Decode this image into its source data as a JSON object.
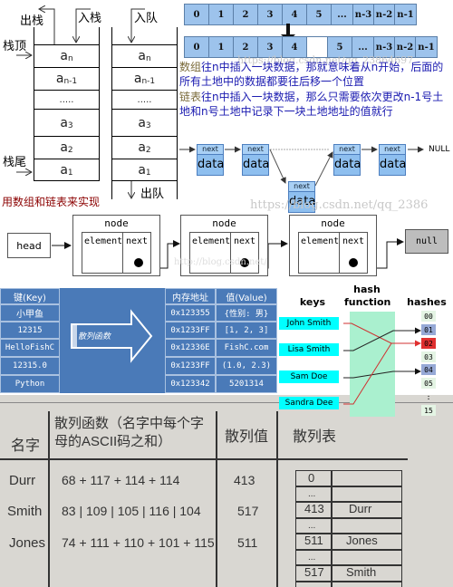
{
  "stack_queue": {
    "stack_pop": "出栈",
    "stack_push": "入栈",
    "queue_enqueue": "入队",
    "queue_dequeue": "出队",
    "stack_top": "栈顶",
    "stack_bottom": "栈尾",
    "cells": [
      {
        "base": "a",
        "sub": "n"
      },
      {
        "base": "a",
        "sub": "n-1"
      },
      {
        "base": ".....",
        "sub": ""
      },
      {
        "base": "a",
        "sub": "3"
      },
      {
        "base": "a",
        "sub": "2"
      },
      {
        "base": "a",
        "sub": "1"
      }
    ],
    "note": "用数组和链表来实现"
  },
  "array": {
    "top_row": [
      "0",
      "1",
      "2",
      "3",
      "4",
      "5",
      "...",
      "n-3",
      "n-2",
      "n-1"
    ],
    "bottom_row_left": [
      "0",
      "1",
      "2",
      "3",
      "4"
    ],
    "bottom_row_right": [
      "5",
      "...",
      "n-3",
      "n-2",
      "n-1"
    ]
  },
  "description": {
    "array_word": "数组",
    "array_text": "往n中插入一块数据，那就意味着从n开始，后面的所有土地中的数据都要往后移一个位置",
    "list_word": "链表",
    "list_text": "往n中插入一块数据，那么只需要依次更改n-1号土地和n号土地中记录下一块土地地址的值就行"
  },
  "linked_list": {
    "next_label": "next",
    "data_label": "data",
    "null_label": "NULL",
    "watermark": "https://blog.csdn.net/qq_2386"
  },
  "node_diagram": {
    "head": "head",
    "node_title": "node",
    "element": "element",
    "next": "next",
    "null": "null",
    "watermark": "http://blog.csdn.net/"
  },
  "dict_table": {
    "key_header": "键(Key)",
    "keys": [
      "小甲鱼",
      "12315",
      "HelloFishC",
      "12315.0",
      "Python"
    ],
    "arrow_label": "散列函数",
    "addr_header": "内存地址",
    "value_header": "值(Value)",
    "addresses": [
      "0x123355",
      "0x1233FF",
      "0x12336E",
      "0x1233FF",
      "0x123342"
    ],
    "values": [
      "{性别: 男}",
      "[1, 2, 3]",
      "FishC.com",
      "(1.0, 2.3)",
      "5201314"
    ]
  },
  "hash_function": {
    "keys_title": "keys",
    "function_title_line1": "hash",
    "function_title_line2": "function",
    "hashes_title": "hashes",
    "keys": [
      "John Smith",
      "Lisa Smith",
      "Sam Doe",
      "Sandra Dee"
    ],
    "hashes": [
      "00",
      "01",
      "02",
      "03",
      "04",
      "05",
      ":",
      "15"
    ],
    "colors": {
      "key_bg": "#00ffff",
      "function_bg": "#aaf0cf",
      "collision": "#e03030",
      "selected": "#96a9d6"
    }
  },
  "scanned_table": {
    "headers": [
      "名字",
      "散列函数（名字中每个字",
      "母的ASCII码之和）",
      "散列值",
      "散列表"
    ],
    "rows": [
      {
        "name": "Durr",
        "formula": "68 + 117 + 114 + 114",
        "hash": "413"
      },
      {
        "name": "Smith",
        "formula": "83 | 109 | 105 | 116 | 104",
        "hash": "517"
      },
      {
        "name": "Jones",
        "formula": "74 + 111 + 110 + 101 + 115",
        "hash": "511"
      }
    ],
    "table_slots": [
      {
        "index": "0",
        "value": ""
      },
      {
        "index": "...",
        "value": ""
      },
      {
        "index": "413",
        "value": "Durr"
      },
      {
        "index": "...",
        "value": ""
      },
      {
        "index": "511",
        "value": "Jones"
      },
      {
        "index": "...",
        "value": ""
      },
      {
        "index": "517",
        "value": "Smith"
      }
    ]
  }
}
